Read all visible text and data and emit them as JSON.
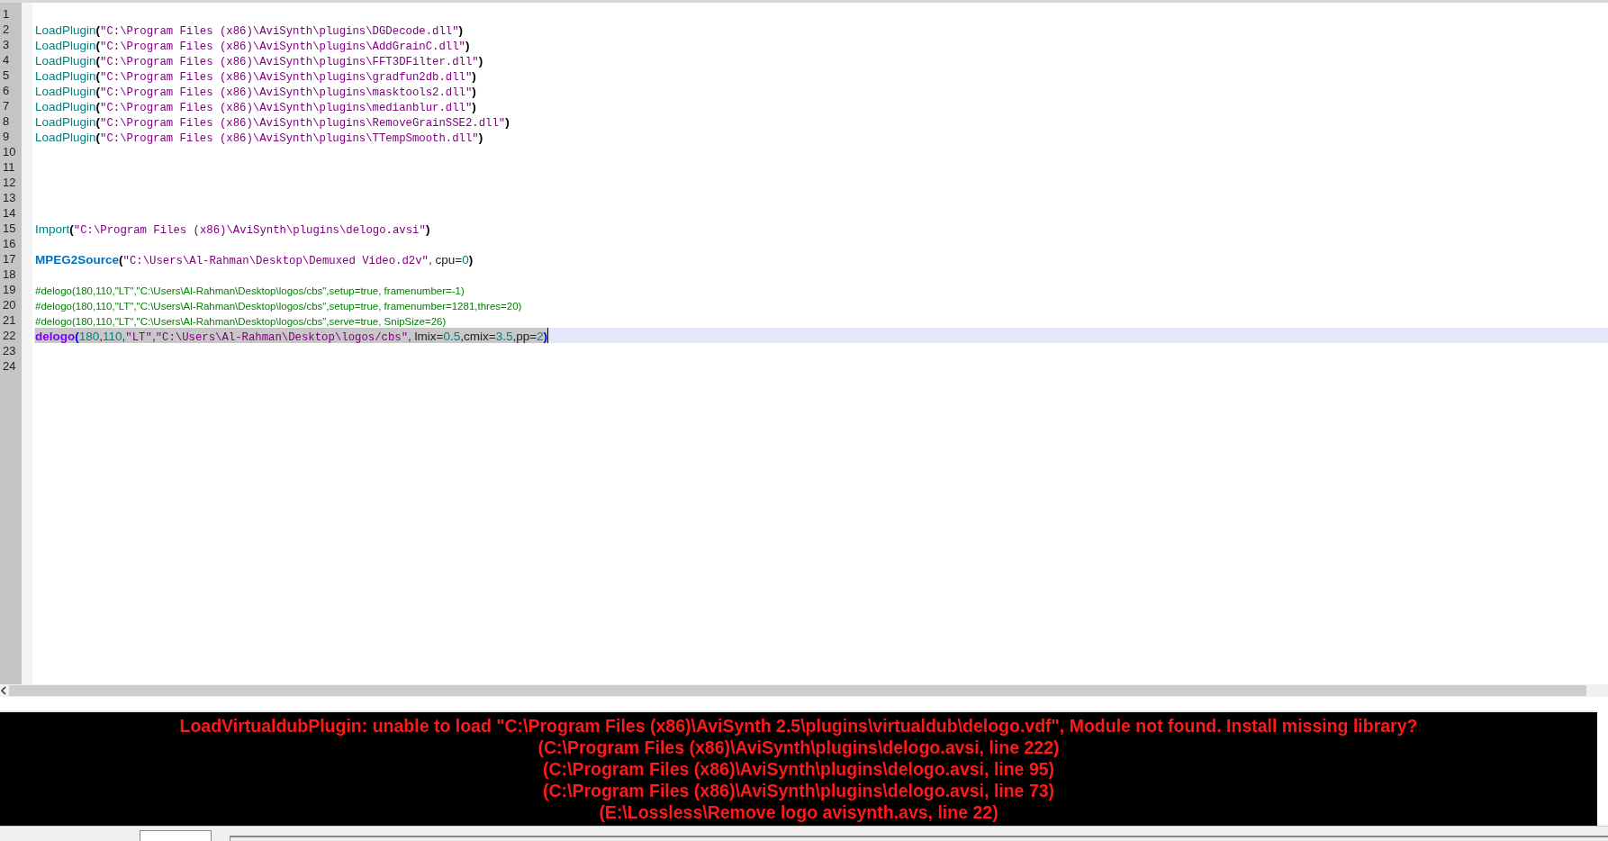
{
  "editor": {
    "lines": [
      {
        "number": "1",
        "current": false,
        "selected": false
      },
      {
        "number": "2",
        "current": false,
        "selected": false,
        "tokens": [
          {
            "kind": "func",
            "text": "LoadPlugin"
          },
          {
            "kind": "paren",
            "text": "("
          },
          {
            "kind": "string",
            "text": "\"C:\\Program Files (x86)\\AviSynth\\plugins\\DGDecode.dll\""
          },
          {
            "kind": "paren",
            "text": ")"
          }
        ]
      },
      {
        "number": "3",
        "current": false,
        "selected": false,
        "tokens": [
          {
            "kind": "func",
            "text": "LoadPlugin"
          },
          {
            "kind": "paren",
            "text": "("
          },
          {
            "kind": "string",
            "text": "\"C:\\Program Files (x86)\\AviSynth\\plugins\\AddGrainC.dll\""
          },
          {
            "kind": "paren",
            "text": ")"
          }
        ]
      },
      {
        "number": "4",
        "current": false,
        "selected": false,
        "tokens": [
          {
            "kind": "func",
            "text": "LoadPlugin"
          },
          {
            "kind": "paren",
            "text": "("
          },
          {
            "kind": "string",
            "text": "\"C:\\Program Files (x86)\\AviSynth\\plugins\\FFT3DFilter.dll\""
          },
          {
            "kind": "paren",
            "text": ")"
          }
        ]
      },
      {
        "number": "5",
        "current": false,
        "selected": false,
        "tokens": [
          {
            "kind": "func",
            "text": "LoadPlugin"
          },
          {
            "kind": "paren",
            "text": "("
          },
          {
            "kind": "string",
            "text": "\"C:\\Program Files (x86)\\AviSynth\\plugins\\gradfun2db.dll\""
          },
          {
            "kind": "paren",
            "text": ")"
          }
        ]
      },
      {
        "number": "6",
        "current": false,
        "selected": false,
        "tokens": [
          {
            "kind": "func",
            "text": "LoadPlugin"
          },
          {
            "kind": "paren",
            "text": "("
          },
          {
            "kind": "string",
            "text": "\"C:\\Program Files (x86)\\AviSynth\\plugins\\masktools2.dll\""
          },
          {
            "kind": "paren",
            "text": ")"
          }
        ]
      },
      {
        "number": "7",
        "current": false,
        "selected": false,
        "tokens": [
          {
            "kind": "func",
            "text": "LoadPlugin"
          },
          {
            "kind": "paren",
            "text": "("
          },
          {
            "kind": "string",
            "text": "\"C:\\Program Files (x86)\\AviSynth\\plugins\\medianblur.dll\""
          },
          {
            "kind": "paren",
            "text": ")"
          }
        ]
      },
      {
        "number": "8",
        "current": false,
        "selected": false,
        "tokens": [
          {
            "kind": "func",
            "text": "LoadPlugin"
          },
          {
            "kind": "paren",
            "text": "("
          },
          {
            "kind": "string",
            "text": "\"C:\\Program Files (x86)\\AviSynth\\plugins\\RemoveGrainSSE2.dll\""
          },
          {
            "kind": "paren",
            "text": ")"
          }
        ]
      },
      {
        "number": "9",
        "current": false,
        "selected": false,
        "tokens": [
          {
            "kind": "func",
            "text": "LoadPlugin"
          },
          {
            "kind": "paren",
            "text": "("
          },
          {
            "kind": "string",
            "text": "\"C:\\Program Files (x86)\\AviSynth\\plugins\\TTempSmooth.dll\""
          },
          {
            "kind": "paren",
            "text": ")"
          }
        ]
      },
      {
        "number": "10",
        "current": false,
        "selected": false
      },
      {
        "number": "11",
        "current": false,
        "selected": false
      },
      {
        "number": "12",
        "current": false,
        "selected": false
      },
      {
        "number": "13",
        "current": false,
        "selected": false
      },
      {
        "number": "14",
        "current": false,
        "selected": false
      },
      {
        "number": "15",
        "current": false,
        "selected": false,
        "tokens": [
          {
            "kind": "func",
            "text": "Import"
          },
          {
            "kind": "paren",
            "text": "("
          },
          {
            "kind": "string",
            "text": "\"C:\\Program Files (x86)\\AviSynth\\plugins\\delogo.avsi\""
          },
          {
            "kind": "paren",
            "text": ")"
          }
        ]
      },
      {
        "number": "16",
        "current": false,
        "selected": false
      },
      {
        "number": "17",
        "current": false,
        "selected": false,
        "tokens": [
          {
            "kind": "keyword",
            "text": "MPEG2Source"
          },
          {
            "kind": "paren",
            "text": "("
          },
          {
            "kind": "string",
            "text": "\"C:\\Users\\Al-Rahman\\Desktop\\Demuxed Video.d2v\""
          },
          {
            "kind": "plain",
            "text": ", cpu="
          },
          {
            "kind": "number",
            "text": "0"
          },
          {
            "kind": "paren",
            "text": ")"
          }
        ]
      },
      {
        "number": "18",
        "current": false,
        "selected": false
      },
      {
        "number": "19",
        "current": false,
        "selected": false,
        "tokens": [
          {
            "kind": "comment",
            "text": "#delogo(180,110,\"LT\",\"C:\\Users\\Al-Rahman\\Desktop\\logos/cbs\",setup=true, framenumber=-1)"
          }
        ]
      },
      {
        "number": "20",
        "current": false,
        "selected": false,
        "tokens": [
          {
            "kind": "comment",
            "text": "#delogo(180,110,\"LT\",\"C:\\Users\\Al-Rahman\\Desktop\\logos/cbs\",setup=true, framenumber=1281,thres=20)"
          }
        ]
      },
      {
        "number": "21",
        "current": false,
        "selected": false,
        "tokens": [
          {
            "kind": "comment",
            "text": "#delogo(180,110,\"LT\",\"C:\\Users\\Al-Rahman\\Desktop\\logos/cbs\",serve=true, SnipSize=26)"
          }
        ]
      },
      {
        "number": "22",
        "current": true,
        "selected": true,
        "tokens": [
          {
            "kind": "keyword2",
            "text": "delogo"
          },
          {
            "kind": "brace",
            "text": "("
          },
          {
            "kind": "number",
            "text": "180"
          },
          {
            "kind": "plain",
            "text": ","
          },
          {
            "kind": "number",
            "text": "110"
          },
          {
            "kind": "plain",
            "text": ","
          },
          {
            "kind": "string",
            "text": "\"LT\""
          },
          {
            "kind": "plain",
            "text": ","
          },
          {
            "kind": "string",
            "text": "\"C:\\Users\\Al-Rahman\\Desktop\\logos/cbs\""
          },
          {
            "kind": "plain",
            "text": ", lmix="
          },
          {
            "kind": "number",
            "text": "0.5"
          },
          {
            "kind": "plain",
            "text": ",cmix="
          },
          {
            "kind": "number",
            "text": "3.5"
          },
          {
            "kind": "plain",
            "text": ",pp="
          },
          {
            "kind": "number",
            "text": "2"
          },
          {
            "kind": "brace",
            "text": ")"
          }
        ]
      },
      {
        "number": "23",
        "current": false,
        "selected": false
      },
      {
        "number": "24",
        "current": false,
        "selected": false
      }
    ]
  },
  "error_panel": {
    "lines": [
      "LoadVirtualdubPlugin: unable to load \"C:\\Program Files (x86)\\AviSynth 2.5\\plugins\\virtualdub\\delogo.vdf\", Module not found.  Install missing library?",
      "(C:\\Program Files (x86)\\AviSynth\\plugins\\delogo.avsi, line 222)",
      "(C:\\Program Files (x86)\\AviSynth\\plugins\\delogo.avsi, line 95)",
      "(C:\\Program Files (x86)\\AviSynth\\plugins\\delogo.avsi, line 73)",
      "(E:\\Lossless\\Remove logo avisynth.avs, line 22)"
    ]
  }
}
